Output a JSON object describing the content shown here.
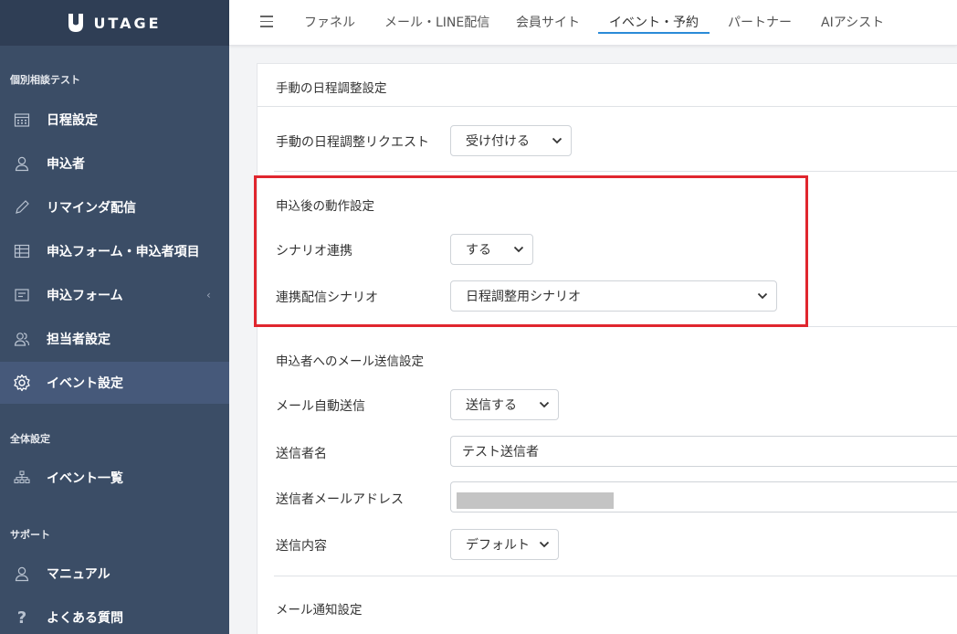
{
  "sidebar": {
    "logo": "UTAGE",
    "section1": "個別相談テスト",
    "items1": [
      {
        "label": "日程設定",
        "icon": "calendar-icon"
      },
      {
        "label": "申込者",
        "icon": "user-icon"
      },
      {
        "label": "リマインダ配信",
        "icon": "pencil-icon"
      },
      {
        "label": "申込フォーム・申込者項目",
        "icon": "table-icon"
      },
      {
        "label": "申込フォーム",
        "icon": "form-icon"
      },
      {
        "label": "担当者設定",
        "icon": "users-icon"
      },
      {
        "label": "イベント設定",
        "icon": "gear-icon"
      }
    ],
    "section2": "全体設定",
    "items2": [
      {
        "label": "イベント一覧",
        "icon": "sitemap-icon"
      }
    ],
    "section3": "サポート",
    "items3": [
      {
        "label": "マニュアル",
        "icon": "user-icon"
      },
      {
        "label": "よくある質問",
        "icon": "question-icon"
      }
    ]
  },
  "topnav": {
    "tabs": [
      "ファネル",
      "メール・LINE配信",
      "会員サイト",
      "イベント・予約",
      "パートナー",
      "AIアシスト"
    ],
    "active_tab": "イベント・予約"
  },
  "main": {
    "manual_heading": "手動の日程調整設定",
    "manual_request_label": "手動の日程調整リクエスト",
    "manual_request_value": "受け付ける",
    "after_heading": "申込後の動作設定",
    "scenario_link_label": "シナリオ連携",
    "scenario_link_value": "する",
    "linked_scenario_label": "連携配信シナリオ",
    "linked_scenario_value": "日程調整用シナリオ",
    "mail_heading": "申込者へのメール送信設定",
    "auto_send_label": "メール自動送信",
    "auto_send_value": "送信する",
    "sender_name_label": "送信者名",
    "sender_name_value": "テスト送信者",
    "sender_email_label": "送信者メールアドレス",
    "content_label": "送信内容",
    "content_value": "デフォルト",
    "notify_heading": "メール通知設定"
  },
  "colors": {
    "sidebar_bg": "#3b4d66",
    "sidebar_active": "#46597a",
    "accent": "#2a8bd8",
    "highlight": "#e0262e"
  }
}
